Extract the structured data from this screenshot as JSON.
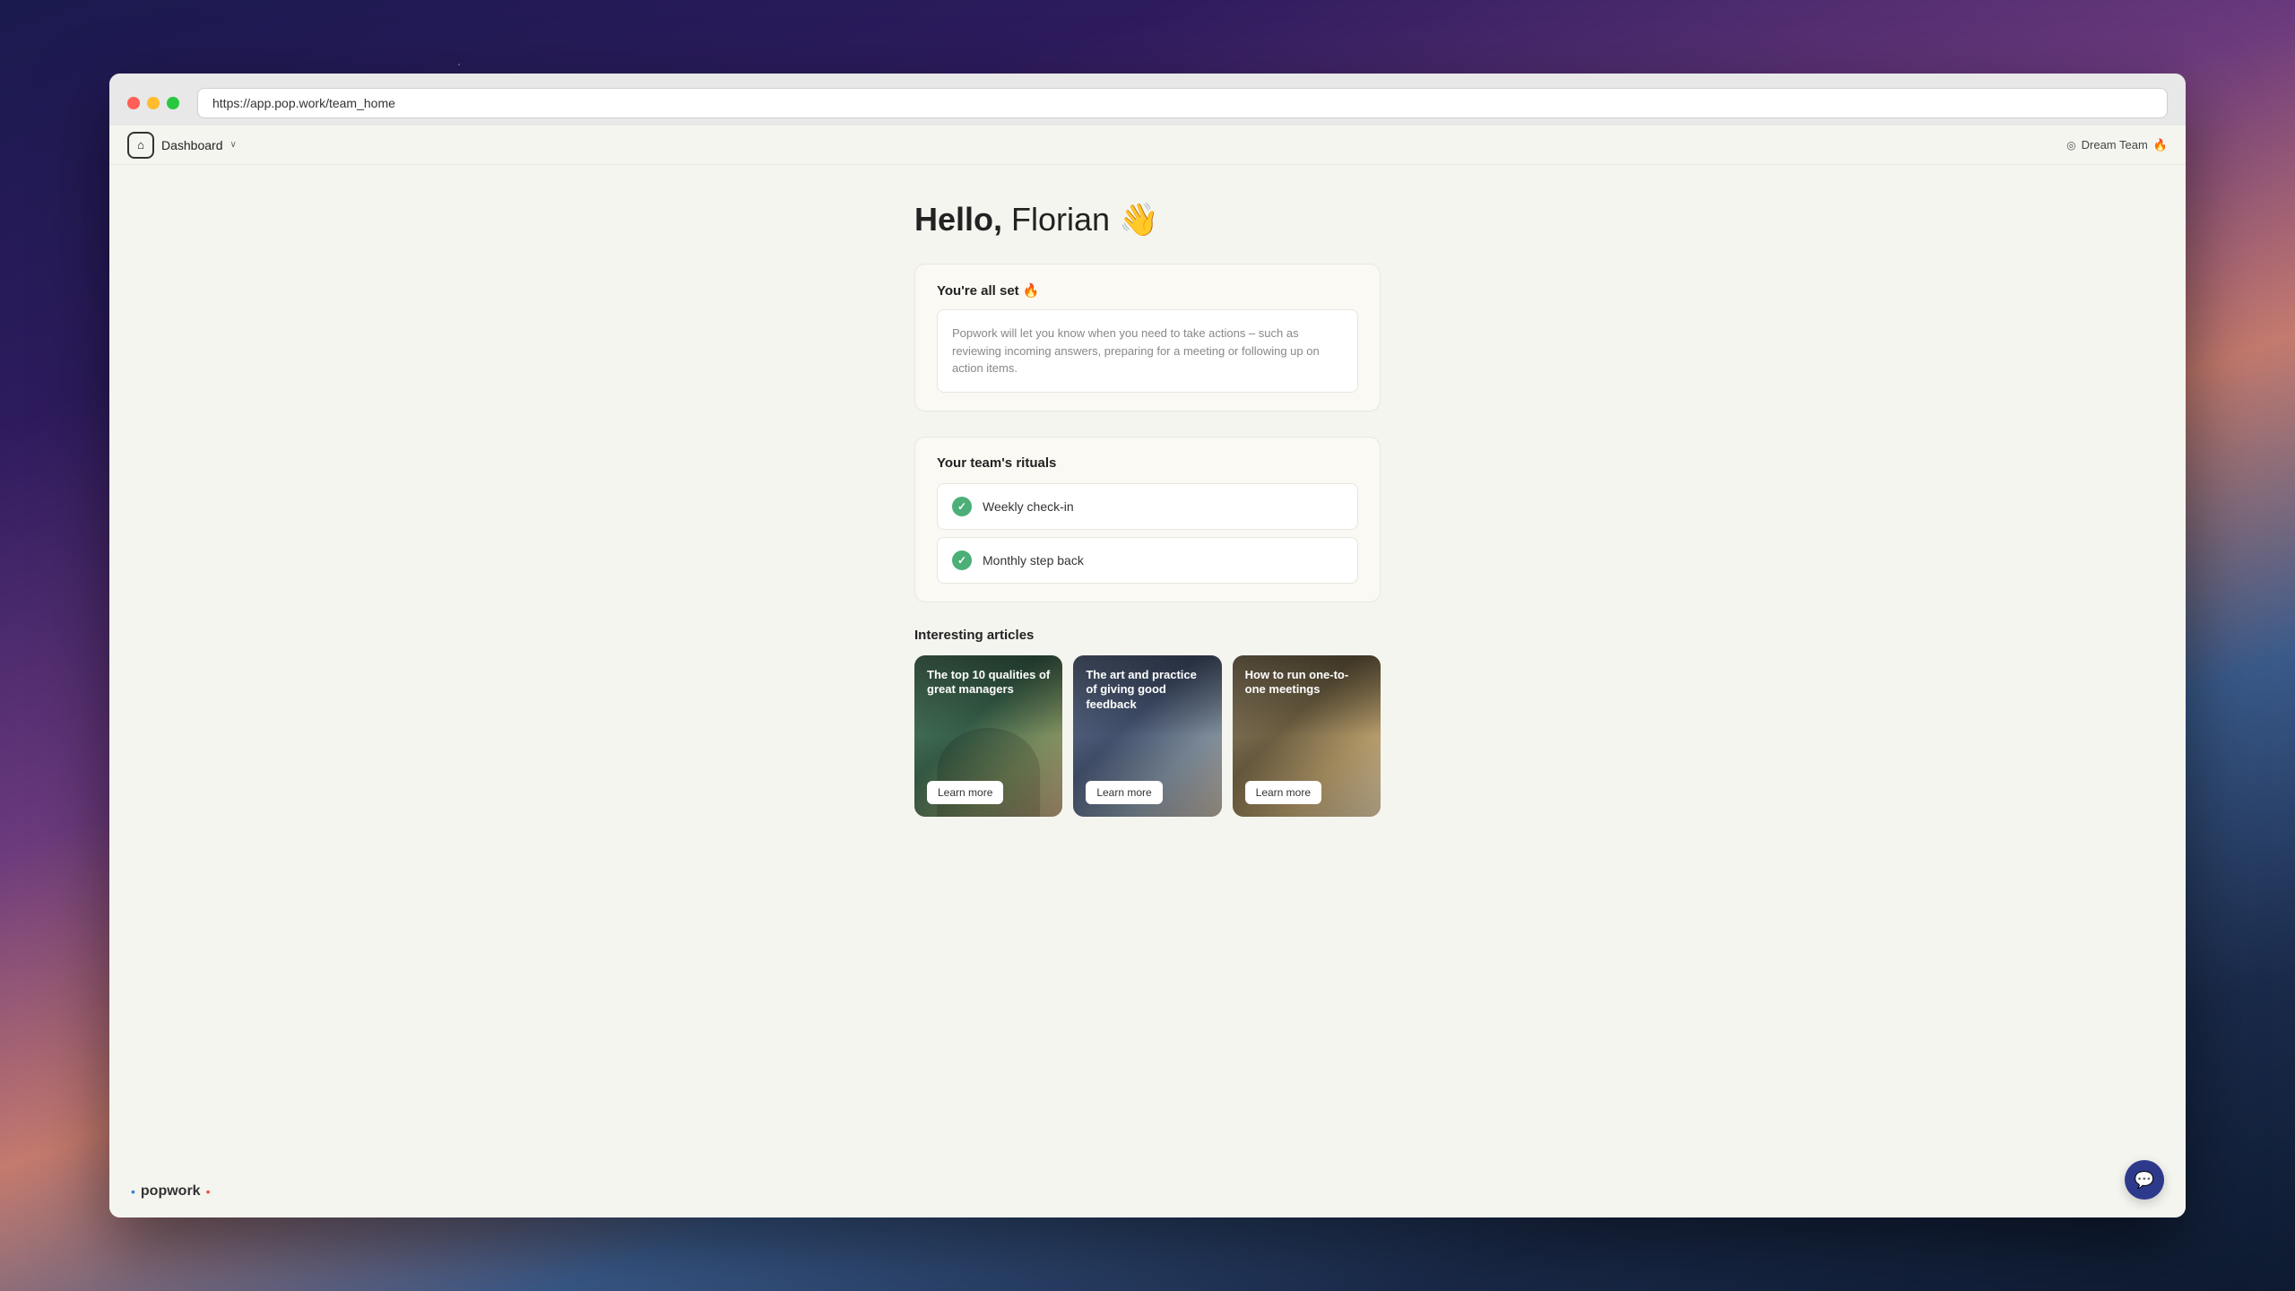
{
  "browser": {
    "url": "https://app.pop.work/team_home",
    "traffic_lights": {
      "red": "close",
      "yellow": "minimize",
      "green": "maximize"
    }
  },
  "nav": {
    "home_icon": "🏠",
    "dashboard_label": "Dashboard",
    "chevron": "∨",
    "team_icon": "◎",
    "team_name": "Dream Team",
    "team_fire": "🔥"
  },
  "page": {
    "greeting_bold": "Hello,",
    "greeting_name": " Florian",
    "greeting_emoji": "👋"
  },
  "all_set": {
    "title": "You're all set 🔥",
    "body_text": "Popwork will let you know when you need to take actions – such as reviewing incoming answers, preparing for a meeting or following up on action items."
  },
  "rituals": {
    "title": "Your team's rituals",
    "items": [
      {
        "label": "Weekly check-in",
        "checked": true
      },
      {
        "label": "Monthly step back",
        "checked": true
      }
    ]
  },
  "articles": {
    "title": "Interesting articles",
    "items": [
      {
        "title": "The top 10 qualities of great managers",
        "cta": "Learn more"
      },
      {
        "title": "The art and practice of giving good feedback",
        "cta": "Learn more"
      },
      {
        "title": "How to run one-to-one meetings",
        "cta": "Learn more"
      }
    ]
  },
  "logo": {
    "text": "• popwork •"
  },
  "chat_button": {
    "icon": "💬"
  }
}
